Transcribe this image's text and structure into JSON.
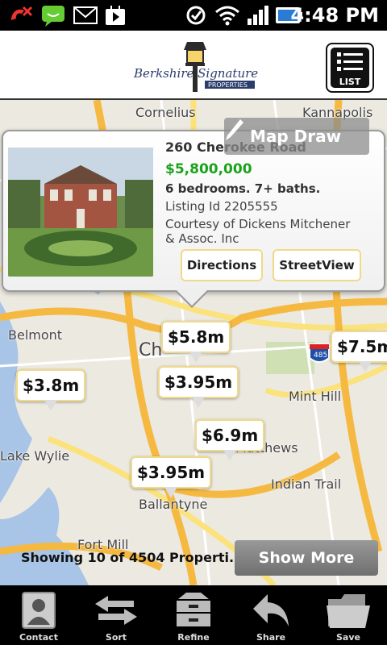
{
  "status_bar": {
    "time": "4:48 PM",
    "icons": [
      "missed-call-icon",
      "chat-icon",
      "voicemail-icon",
      "play-store-icon",
      "sync-icon",
      "wifi-icon",
      "signal-icon",
      "battery-icon"
    ]
  },
  "header": {
    "logo_line1": "Berkshire Signature",
    "logo_line2": "PROPERTIES",
    "list_label": "LIST"
  },
  "map": {
    "places": [
      "Cornelius",
      "Kannapolis",
      "Belmont",
      "Ch",
      "Mint Hill",
      "Lake Wylie",
      "Matthews",
      "Indian Trail",
      "Ballantyne",
      "Fort Mill",
      "485"
    ],
    "markers": [
      "$5.8m",
      "$7.5m",
      "$3.8m",
      "$3.95m",
      "$6.9m",
      "$3.95m"
    ],
    "map_draw_label": "Map Draw"
  },
  "popup": {
    "address": "260 Cherokee Road",
    "price": "$5,800,000",
    "beds_baths": "6 bedrooms. 7+ baths.",
    "listing_id": "Listing Id 2205555",
    "courtesy": "Courtesy of Dickens Mitchener & Assoc. Inc",
    "directions_label": "Directions",
    "streetview_label": "StreetView"
  },
  "results": {
    "showing_text": "Showing 10 of 4504 Properti...",
    "show_more_label": "Show More"
  },
  "toolbar": {
    "items": [
      {
        "label": "Contact",
        "icon": "contact-icon"
      },
      {
        "label": "Sort",
        "icon": "sort-arrows-icon"
      },
      {
        "label": "Refine",
        "icon": "refine-cabinet-icon"
      },
      {
        "label": "Share",
        "icon": "share-arrow-icon"
      },
      {
        "label": "Save",
        "icon": "save-folder-icon"
      }
    ]
  },
  "colors": {
    "price_green": "#1aa31a",
    "road_orange": "#f5b942",
    "road_yellow": "#fbe27a",
    "marker_border": "#f1d98a",
    "water_blue": "#a8c4e6"
  }
}
